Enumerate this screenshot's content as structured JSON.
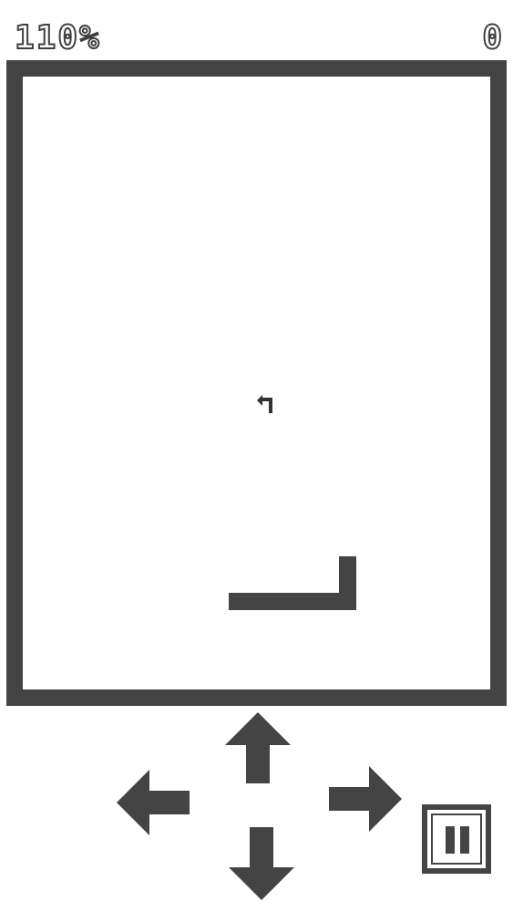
{
  "hud": {
    "left_value": "110%",
    "right_value": "0"
  },
  "colors": {
    "board_border": "#444444",
    "snake": "#444444",
    "background": "#ffffff"
  },
  "food": {
    "icon": "turn-left-arrow-icon"
  },
  "controls": {
    "up": "arrow-up-icon",
    "down": "arrow-down-icon",
    "left": "arrow-left-icon",
    "right": "arrow-right-icon",
    "pause": "pause-icon"
  }
}
